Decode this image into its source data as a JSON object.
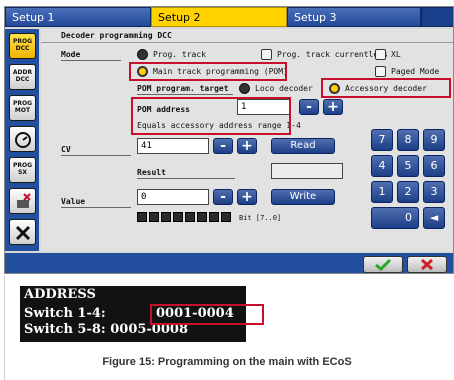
{
  "tabs": [
    {
      "label": "Setup 1"
    },
    {
      "label": "Setup 2"
    },
    {
      "label": "Setup 3"
    }
  ],
  "sidebar": {
    "items": [
      {
        "label": "PROG DCC"
      },
      {
        "label": "ADDR DCC"
      },
      {
        "label": "PROG MOT"
      },
      {
        "label": ""
      },
      {
        "label": "PROG SX"
      },
      {
        "label": ""
      },
      {
        "label": ""
      }
    ]
  },
  "panel": {
    "header": "Decoder programming DCC",
    "mode_label": "Mode",
    "prog_track": "Prog. track",
    "prog_track_currentless": "Prog. track currentless",
    "xl": "XL",
    "main_track": "Main track programming (POM)",
    "paged_mode": "Paged Mode",
    "pom_target_label": "POM program. target",
    "loco_decoder": "Loco decoder",
    "accessory_decoder": "Accessory decoder",
    "pom_address_label": "POM address",
    "pom_address_value": "1",
    "pom_address_hint": "Equals accessory address range 1-4",
    "cv_label": "CV",
    "cv_value": "41",
    "read_label": "Read",
    "result_label": "Result",
    "result_value": "",
    "value_label": "Value",
    "value_value": "0",
    "write_label": "Write",
    "bit_label": "Bit [7..0]"
  },
  "keypad": {
    "keys": [
      "7",
      "8",
      "9",
      "4",
      "5",
      "6",
      "1",
      "2",
      "3",
      "0",
      "◄"
    ]
  },
  "buttons": {
    "minus": "-",
    "plus": "+"
  },
  "lcd": {
    "line1": "ADDRESS",
    "line2_prefix": "Switch 1-4:",
    "line2_value": "0001-0004",
    "line3": "Switch 5-8: 0005-0008"
  },
  "caption": "Figure 15: Programming on the main with ECoS",
  "colors": {
    "accent": "#ffd200",
    "highlight": "#c8102e",
    "tab_blue": "#1a3f8a",
    "ok_green": "#28a828",
    "cancel_red": "#d0202a"
  }
}
